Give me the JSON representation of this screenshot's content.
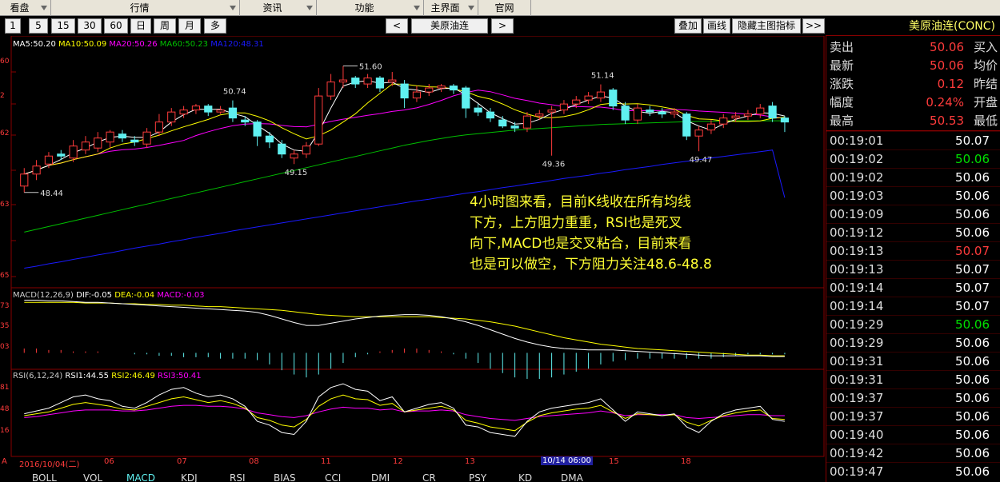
{
  "menu": {
    "items": [
      "看盘",
      "行情",
      "资讯",
      "功能",
      "主界面",
      "官网"
    ]
  },
  "toolbar": {
    "periods": [
      "1",
      "5",
      "15",
      "30",
      "60",
      "日",
      "周",
      "月",
      "多"
    ],
    "prev": "<",
    "symbol": "美原油连",
    "next": ">",
    "overlay": "叠加",
    "draw": "画线",
    "hide_indicator": "隐藏主图指标",
    "more": ">>"
  },
  "title": "美原油连(CONC)",
  "ma_legend": {
    "ma5": "MA5:50.20",
    "ma10": "MA10:50.09",
    "ma20": "MA20:50.26",
    "ma60": "MA60:50.23",
    "ma120": "MA120:48.31"
  },
  "price_axis": [
    "60",
    "2",
    "62",
    "63",
    "65"
  ],
  "price_annotations": {
    "low1": "48.44",
    "high1": "50.74",
    "peak": "51.60",
    "low2": "49.15",
    "high2": "51.14",
    "low3": "49.36",
    "low4": "49.47"
  },
  "comment_lines": [
    "4小时图来看，目前K线收在所有均线",
    "下方，上方阻力重重，RSI也是死叉",
    "向下,MACD也是交叉粘合，目前来看",
    "也是可以做空，下方阻力关注48.6-48.8"
  ],
  "macd_legend": {
    "name": "MACD(12,26,9)",
    "dif": "DIF:-0.05",
    "dea": "DEA:-0.04",
    "macd": "MACD:-0.03"
  },
  "macd_axis": [
    "73",
    "35",
    "03"
  ],
  "rsi_legend": {
    "name": "RSI(6,12,24)",
    "rsi1": "RSI1:44.55",
    "rsi2": "RSI2:46.49",
    "rsi3": "RSI3:50.41"
  },
  "rsi_axis": [
    "81",
    "48",
    "16"
  ],
  "date_axis": {
    "labels": [
      "2016/10/04(二)",
      "06",
      "07",
      "08",
      "11",
      "12",
      "13",
      "10/14 06:00",
      "15",
      "18"
    ],
    "corner": "A"
  },
  "bottom_tabs": [
    "BOLL",
    "VOL",
    "MACD",
    "KDJ",
    "RSI",
    "BIAS",
    "CCI",
    "DMI",
    "CR",
    "PSY",
    "KD",
    "DMA"
  ],
  "quote": {
    "rows": [
      {
        "key": "卖出",
        "value": "50.06",
        "key2": "买入"
      },
      {
        "key": "最新",
        "value": "50.06",
        "key2": "均价"
      },
      {
        "key": "涨跌",
        "value": "0.12",
        "key2": "昨结"
      },
      {
        "key": "幅度",
        "value": "0.24%",
        "key2": "开盘"
      },
      {
        "key": "最高",
        "value": "50.53",
        "key2": "最低"
      }
    ],
    "ticks": [
      {
        "time": "00:19:01",
        "price": "50.07",
        "color": "#ffffff"
      },
      {
        "time": "00:19:02",
        "price": "50.06",
        "color": "#00e000"
      },
      {
        "time": "00:19:02",
        "price": "50.06",
        "color": "#ffffff"
      },
      {
        "time": "00:19:03",
        "price": "50.06",
        "color": "#ffffff"
      },
      {
        "time": "00:19:09",
        "price": "50.06",
        "color": "#ffffff"
      },
      {
        "time": "00:19:12",
        "price": "50.06",
        "color": "#ffffff"
      },
      {
        "time": "00:19:13",
        "price": "50.07",
        "color": "#ff3b3b"
      },
      {
        "time": "00:19:13",
        "price": "50.07",
        "color": "#ffffff"
      },
      {
        "time": "00:19:14",
        "price": "50.07",
        "color": "#ffffff"
      },
      {
        "time": "00:19:14",
        "price": "50.07",
        "color": "#ffffff"
      },
      {
        "time": "00:19:29",
        "price": "50.06",
        "color": "#00e000"
      },
      {
        "time": "00:19:29",
        "price": "50.06",
        "color": "#ffffff"
      },
      {
        "time": "00:19:31",
        "price": "50.06",
        "color": "#ffffff"
      },
      {
        "time": "00:19:31",
        "price": "50.06",
        "color": "#ffffff"
      },
      {
        "time": "00:19:37",
        "price": "50.06",
        "color": "#ffffff"
      },
      {
        "time": "00:19:37",
        "price": "50.06",
        "color": "#ffffff"
      },
      {
        "time": "00:19:40",
        "price": "50.06",
        "color": "#ffffff"
      },
      {
        "time": "00:19:42",
        "price": "50.06",
        "color": "#ffffff"
      },
      {
        "time": "00:19:47",
        "price": "50.06",
        "color": "#ffffff"
      }
    ]
  },
  "colors": {
    "up": "#ff3b3b",
    "down": "#5ff0f0",
    "ma5": "#ffffff",
    "ma10": "#ffff00",
    "ma20": "#ff00ff",
    "ma60": "#00c000",
    "ma120": "#1a1aff",
    "comment": "#ffff33"
  },
  "chart_data": {
    "type": "candlestick",
    "candles": [
      {
        "o": 48.6,
        "c": 48.9,
        "h": 49.05,
        "l": 48.44
      },
      {
        "o": 48.9,
        "c": 49.1,
        "h": 49.25,
        "l": 48.75
      },
      {
        "o": 49.15,
        "c": 49.35,
        "h": 49.45,
        "l": 49.05
      },
      {
        "o": 49.4,
        "c": 49.35,
        "h": 49.5,
        "l": 49.25
      },
      {
        "o": 49.3,
        "c": 49.6,
        "h": 49.75,
        "l": 49.2
      },
      {
        "o": 49.5,
        "c": 49.7,
        "h": 49.85,
        "l": 49.4
      },
      {
        "o": 49.55,
        "c": 49.8,
        "h": 49.95,
        "l": 49.45
      },
      {
        "o": 49.7,
        "c": 49.95,
        "h": 50.0,
        "l": 49.55
      },
      {
        "o": 49.9,
        "c": 49.8,
        "h": 50.0,
        "l": 49.7
      },
      {
        "o": 49.75,
        "c": 49.7,
        "h": 49.85,
        "l": 49.6
      },
      {
        "o": 49.65,
        "c": 49.95,
        "h": 50.05,
        "l": 49.55
      },
      {
        "o": 49.95,
        "c": 50.2,
        "h": 50.4,
        "l": 49.85
      },
      {
        "o": 50.2,
        "c": 50.45,
        "h": 50.55,
        "l": 50.1
      },
      {
        "o": 50.4,
        "c": 50.5,
        "h": 50.6,
        "l": 50.3
      },
      {
        "o": 50.5,
        "c": 50.6,
        "h": 50.65,
        "l": 50.4
      },
      {
        "o": 50.6,
        "c": 50.45,
        "h": 50.65,
        "l": 50.35
      },
      {
        "o": 50.45,
        "c": 50.5,
        "h": 50.6,
        "l": 50.4
      },
      {
        "o": 50.55,
        "c": 50.3,
        "h": 50.74,
        "l": 50.2
      },
      {
        "o": 50.25,
        "c": 50.2,
        "h": 50.35,
        "l": 50.1
      },
      {
        "o": 50.2,
        "c": 49.85,
        "h": 50.25,
        "l": 49.6
      },
      {
        "o": 49.85,
        "c": 49.7,
        "h": 49.95,
        "l": 49.55
      },
      {
        "o": 49.65,
        "c": 49.4,
        "h": 49.75,
        "l": 49.3
      },
      {
        "o": 49.3,
        "c": 49.4,
        "h": 49.5,
        "l": 49.15
      },
      {
        "o": 49.4,
        "c": 49.6,
        "h": 49.7,
        "l": 49.3
      },
      {
        "o": 49.65,
        "c": 50.85,
        "h": 51.05,
        "l": 49.6
      },
      {
        "o": 50.85,
        "c": 51.2,
        "h": 51.4,
        "l": 50.75
      },
      {
        "o": 51.2,
        "c": 51.25,
        "h": 51.6,
        "l": 51.05
      },
      {
        "o": 51.3,
        "c": 51.15,
        "h": 51.35,
        "l": 51.05
      },
      {
        "o": 51.15,
        "c": 51.3,
        "h": 51.4,
        "l": 51.05
      },
      {
        "o": 51.3,
        "c": 51.05,
        "h": 51.35,
        "l": 50.95
      },
      {
        "o": 51.2,
        "c": 51.25,
        "h": 51.45,
        "l": 51.1
      },
      {
        "o": 51.15,
        "c": 50.8,
        "h": 51.25,
        "l": 50.55
      },
      {
        "o": 50.8,
        "c": 50.95,
        "h": 51.1,
        "l": 50.7
      },
      {
        "o": 50.95,
        "c": 51.05,
        "h": 51.15,
        "l": 50.85
      },
      {
        "o": 51.05,
        "c": 51.1,
        "h": 51.15,
        "l": 50.95
      },
      {
        "o": 51.1,
        "c": 51.0,
        "h": 51.15,
        "l": 50.9
      },
      {
        "o": 51.05,
        "c": 50.55,
        "h": 51.1,
        "l": 50.3
      },
      {
        "o": 50.55,
        "c": 50.45,
        "h": 50.65,
        "l": 50.35
      },
      {
        "o": 50.45,
        "c": 50.3,
        "h": 50.55,
        "l": 50.2
      },
      {
        "o": 50.25,
        "c": 50.1,
        "h": 50.35,
        "l": 50.05
      },
      {
        "o": 50.1,
        "c": 50.05,
        "h": 50.2,
        "l": 49.95
      },
      {
        "o": 50.05,
        "c": 50.35,
        "h": 50.45,
        "l": 49.95
      },
      {
        "o": 50.35,
        "c": 50.4,
        "h": 50.5,
        "l": 50.25
      },
      {
        "o": 50.45,
        "c": 50.5,
        "h": 50.6,
        "l": 49.36
      },
      {
        "o": 50.5,
        "c": 50.65,
        "h": 50.75,
        "l": 50.4
      },
      {
        "o": 50.65,
        "c": 50.75,
        "h": 50.85,
        "l": 50.55
      },
      {
        "o": 50.75,
        "c": 50.85,
        "h": 50.95,
        "l": 50.65
      },
      {
        "o": 50.8,
        "c": 50.95,
        "h": 51.14,
        "l": 50.7
      },
      {
        "o": 51.0,
        "c": 50.6,
        "h": 51.05,
        "l": 50.5
      },
      {
        "o": 50.6,
        "c": 50.25,
        "h": 50.7,
        "l": 50.15
      },
      {
        "o": 50.25,
        "c": 50.55,
        "h": 50.65,
        "l": 50.15
      },
      {
        "o": 50.5,
        "c": 50.45,
        "h": 50.6,
        "l": 50.35
      },
      {
        "o": 50.45,
        "c": 50.4,
        "h": 50.55,
        "l": 50.3
      },
      {
        "o": 50.4,
        "c": 50.45,
        "h": 50.55,
        "l": 50.3
      },
      {
        "o": 50.4,
        "c": 49.85,
        "h": 50.45,
        "l": 49.75
      },
      {
        "o": 49.85,
        "c": 50.0,
        "h": 50.1,
        "l": 49.47
      },
      {
        "o": 50.0,
        "c": 50.15,
        "h": 50.25,
        "l": 49.9
      },
      {
        "o": 50.15,
        "c": 50.3,
        "h": 50.4,
        "l": 50.05
      },
      {
        "o": 50.3,
        "c": 50.35,
        "h": 50.45,
        "l": 50.2
      },
      {
        "o": 50.35,
        "c": 50.4,
        "h": 50.5,
        "l": 50.25
      },
      {
        "o": 50.4,
        "c": 50.55,
        "h": 50.65,
        "l": 50.3
      },
      {
        "o": 50.6,
        "c": 50.3,
        "h": 50.7,
        "l": 50.2
      },
      {
        "o": 50.3,
        "c": 50.2,
        "h": 50.35,
        "l": 49.95
      }
    ],
    "ma120": [
      46.55,
      46.6,
      46.66,
      46.71,
      46.77,
      46.82,
      46.88,
      46.93,
      46.99,
      47.05,
      47.1,
      47.15,
      47.21,
      47.26,
      47.32,
      47.37,
      47.42,
      47.48,
      47.53,
      47.58,
      47.63,
      47.68,
      47.73,
      47.78,
      47.83,
      47.88,
      47.93,
      47.98,
      48.03,
      48.08,
      48.13,
      48.18,
      48.23,
      48.27,
      48.32,
      48.37,
      48.42,
      48.46,
      48.51,
      48.56,
      48.6,
      48.65,
      48.69,
      48.74,
      48.79,
      48.83,
      48.87,
      48.92,
      48.96,
      49.01,
      49.05,
      49.09,
      49.14,
      49.18,
      49.22,
      49.26,
      49.3,
      49.34,
      49.38,
      49.42,
      49.46,
      49.5,
      48.31
    ],
    "ma60": [
      47.45,
      47.52,
      47.59,
      47.66,
      47.73,
      47.8,
      47.87,
      47.94,
      48.01,
      48.08,
      48.15,
      48.22,
      48.29,
      48.36,
      48.43,
      48.5,
      48.57,
      48.64,
      48.71,
      48.78,
      48.85,
      48.92,
      48.99,
      49.06,
      49.13,
      49.2,
      49.27,
      49.34,
      49.41,
      49.48,
      49.55,
      49.62,
      49.68,
      49.74,
      49.79,
      49.84,
      49.88,
      49.91,
      49.94,
      49.97,
      50.0,
      50.02,
      50.04,
      50.06,
      50.08,
      50.1,
      50.12,
      50.14,
      50.15,
      50.16,
      50.17,
      50.18,
      50.19,
      50.2,
      50.21,
      50.22,
      50.22,
      50.23,
      50.23,
      50.23,
      50.23,
      50.23,
      50.23
    ],
    "macd_dif": [
      0.73,
      0.73,
      0.72,
      0.72,
      0.71,
      0.7,
      0.7,
      0.69,
      0.68,
      0.67,
      0.66,
      0.65,
      0.64,
      0.63,
      0.62,
      0.61,
      0.6,
      0.59,
      0.58,
      0.56,
      0.52,
      0.47,
      0.42,
      0.38,
      0.38,
      0.41,
      0.44,
      0.47,
      0.49,
      0.51,
      0.52,
      0.53,
      0.53,
      0.52,
      0.5,
      0.47,
      0.43,
      0.38,
      0.32,
      0.26,
      0.2,
      0.15,
      0.11,
      0.08,
      0.06,
      0.05,
      0.04,
      0.04,
      0.04,
      0.03,
      0.02,
      0.01,
      0.0,
      -0.01,
      -0.02,
      -0.03,
      -0.04,
      -0.04,
      -0.04,
      -0.04,
      -0.04,
      -0.05,
      -0.05
    ],
    "macd_dea": [
      0.7,
      0.7,
      0.7,
      0.7,
      0.7,
      0.69,
      0.69,
      0.69,
      0.68,
      0.68,
      0.67,
      0.67,
      0.66,
      0.66,
      0.65,
      0.64,
      0.64,
      0.63,
      0.62,
      0.61,
      0.6,
      0.59,
      0.57,
      0.55,
      0.53,
      0.52,
      0.51,
      0.5,
      0.5,
      0.5,
      0.5,
      0.5,
      0.5,
      0.5,
      0.49,
      0.48,
      0.47,
      0.45,
      0.43,
      0.4,
      0.37,
      0.33,
      0.29,
      0.25,
      0.21,
      0.18,
      0.15,
      0.12,
      0.1,
      0.08,
      0.06,
      0.05,
      0.04,
      0.03,
      0.02,
      0.01,
      0.0,
      -0.01,
      -0.02,
      -0.03,
      -0.03,
      -0.04,
      -0.04
    ],
    "rsi1": [
      52,
      55,
      58,
      64,
      70,
      72,
      68,
      66,
      60,
      58,
      64,
      72,
      78,
      80,
      74,
      70,
      72,
      68,
      60,
      44,
      40,
      32,
      30,
      44,
      70,
      80,
      84,
      78,
      76,
      66,
      70,
      54,
      58,
      62,
      64,
      58,
      40,
      38,
      32,
      30,
      28,
      44,
      54,
      58,
      60,
      62,
      64,
      68,
      56,
      44,
      54,
      52,
      50,
      52,
      38,
      32,
      44,
      52,
      56,
      58,
      60,
      46,
      44
    ],
    "rsi2": [
      50,
      52,
      54,
      58,
      62,
      64,
      62,
      60,
      57,
      56,
      60,
      64,
      68,
      70,
      67,
      64,
      66,
      63,
      58,
      48,
      45,
      40,
      38,
      46,
      60,
      68,
      72,
      68,
      67,
      61,
      63,
      54,
      56,
      58,
      60,
      56,
      45,
      42,
      38,
      36,
      34,
      43,
      50,
      53,
      55,
      57,
      58,
      61,
      54,
      47,
      52,
      51,
      50,
      51,
      43,
      39,
      45,
      50,
      53,
      55,
      56,
      47,
      46
    ],
    "rsi3": [
      48,
      49,
      51,
      53,
      55,
      56,
      56,
      56,
      55,
      55,
      56,
      58,
      60,
      61,
      61,
      60,
      60,
      59,
      57,
      53,
      51,
      49,
      48,
      50,
      54,
      57,
      59,
      58,
      58,
      56,
      57,
      54,
      55,
      55,
      56,
      55,
      51,
      49,
      47,
      46,
      45,
      47,
      49,
      50,
      51,
      52,
      53,
      55,
      53,
      50,
      51,
      51,
      51,
      51,
      48,
      47,
      48,
      49,
      50,
      51,
      51,
      50,
      50
    ]
  }
}
